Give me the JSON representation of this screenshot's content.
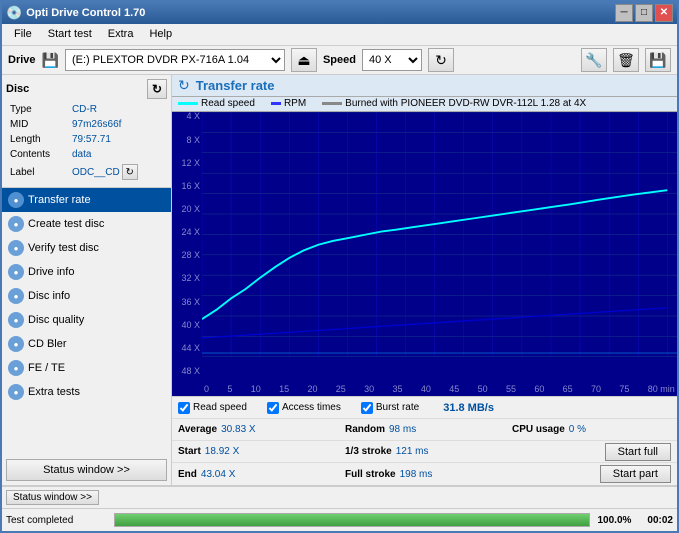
{
  "window": {
    "title": "Opti Drive Control 1.70",
    "min_btn": "─",
    "max_btn": "□",
    "close_btn": "✕"
  },
  "menu": {
    "items": [
      "File",
      "Start test",
      "Extra",
      "Help"
    ]
  },
  "drive_bar": {
    "label": "Drive",
    "drive_value": "(E:)  PLEXTOR DVDR  PX-716A 1.04",
    "speed_label": "Speed",
    "speed_value": "40 X"
  },
  "disc": {
    "header": "Disc",
    "type_label": "Type",
    "type_value": "CD-R",
    "mid_label": "MID",
    "mid_value": "97m26s66f",
    "length_label": "Length",
    "length_value": "79:57.71",
    "contents_label": "Contents",
    "contents_value": "data",
    "label_label": "Label",
    "label_value": "ODC__CD"
  },
  "nav": {
    "items": [
      {
        "id": "transfer-rate",
        "label": "Transfer rate",
        "active": true
      },
      {
        "id": "create-test-disc",
        "label": "Create test disc",
        "active": false
      },
      {
        "id": "verify-test-disc",
        "label": "Verify test disc",
        "active": false
      },
      {
        "id": "drive-info",
        "label": "Drive info",
        "active": false
      },
      {
        "id": "disc-info",
        "label": "Disc info",
        "active": false
      },
      {
        "id": "disc-quality",
        "label": "Disc quality",
        "active": false
      },
      {
        "id": "cd-bler",
        "label": "CD Bler",
        "active": false
      },
      {
        "id": "fe-te",
        "label": "FE / TE",
        "active": false
      },
      {
        "id": "extra-tests",
        "label": "Extra tests",
        "active": false
      }
    ],
    "status_btn": "Status window >>"
  },
  "chart": {
    "title": "Transfer rate",
    "legend": [
      {
        "label": "Read speed",
        "color": "#00ffff"
      },
      {
        "label": "RPM",
        "color": "#0000ff"
      },
      {
        "label": "Burned with PIONEER DVD-RW  DVR-112L 1.28 at 4X",
        "color": "#888888"
      }
    ],
    "y_labels": [
      "48 X",
      "44 X",
      "40 X",
      "36 X",
      "32 X",
      "28 X",
      "24 X",
      "20 X",
      "16 X",
      "12 X",
      "8 X",
      "4 X"
    ],
    "x_labels": [
      "0",
      "5",
      "10",
      "15",
      "20",
      "25",
      "30",
      "35",
      "40",
      "45",
      "50",
      "55",
      "60",
      "65",
      "70",
      "75",
      "80 min"
    ]
  },
  "bottom": {
    "checkboxes": [
      {
        "label": "Read speed",
        "checked": true
      },
      {
        "label": "Access times",
        "checked": true
      },
      {
        "label": "Burst rate",
        "checked": true
      }
    ],
    "burst_value": "31.8 MB/s",
    "avg_label": "Average",
    "avg_value": "30.83 X",
    "random_label": "Random",
    "random_value": "98 ms",
    "cpu_label": "CPU usage",
    "cpu_value": "0 %",
    "start_label": "Start",
    "start_value": "18.92 X",
    "stroke1_3_label": "1/3 stroke",
    "stroke1_3_value": "121 ms",
    "start_full_btn": "Start full",
    "end_label": "End",
    "end_value": "43.04 X",
    "full_stroke_label": "Full stroke",
    "full_stroke_value": "198 ms",
    "start_part_btn": "Start part"
  },
  "status_bar": {
    "status_window_btn": "Status window >>",
    "test_completed_label": "Test completed",
    "progress_percent": "100.0%",
    "time_value": "00:02"
  }
}
